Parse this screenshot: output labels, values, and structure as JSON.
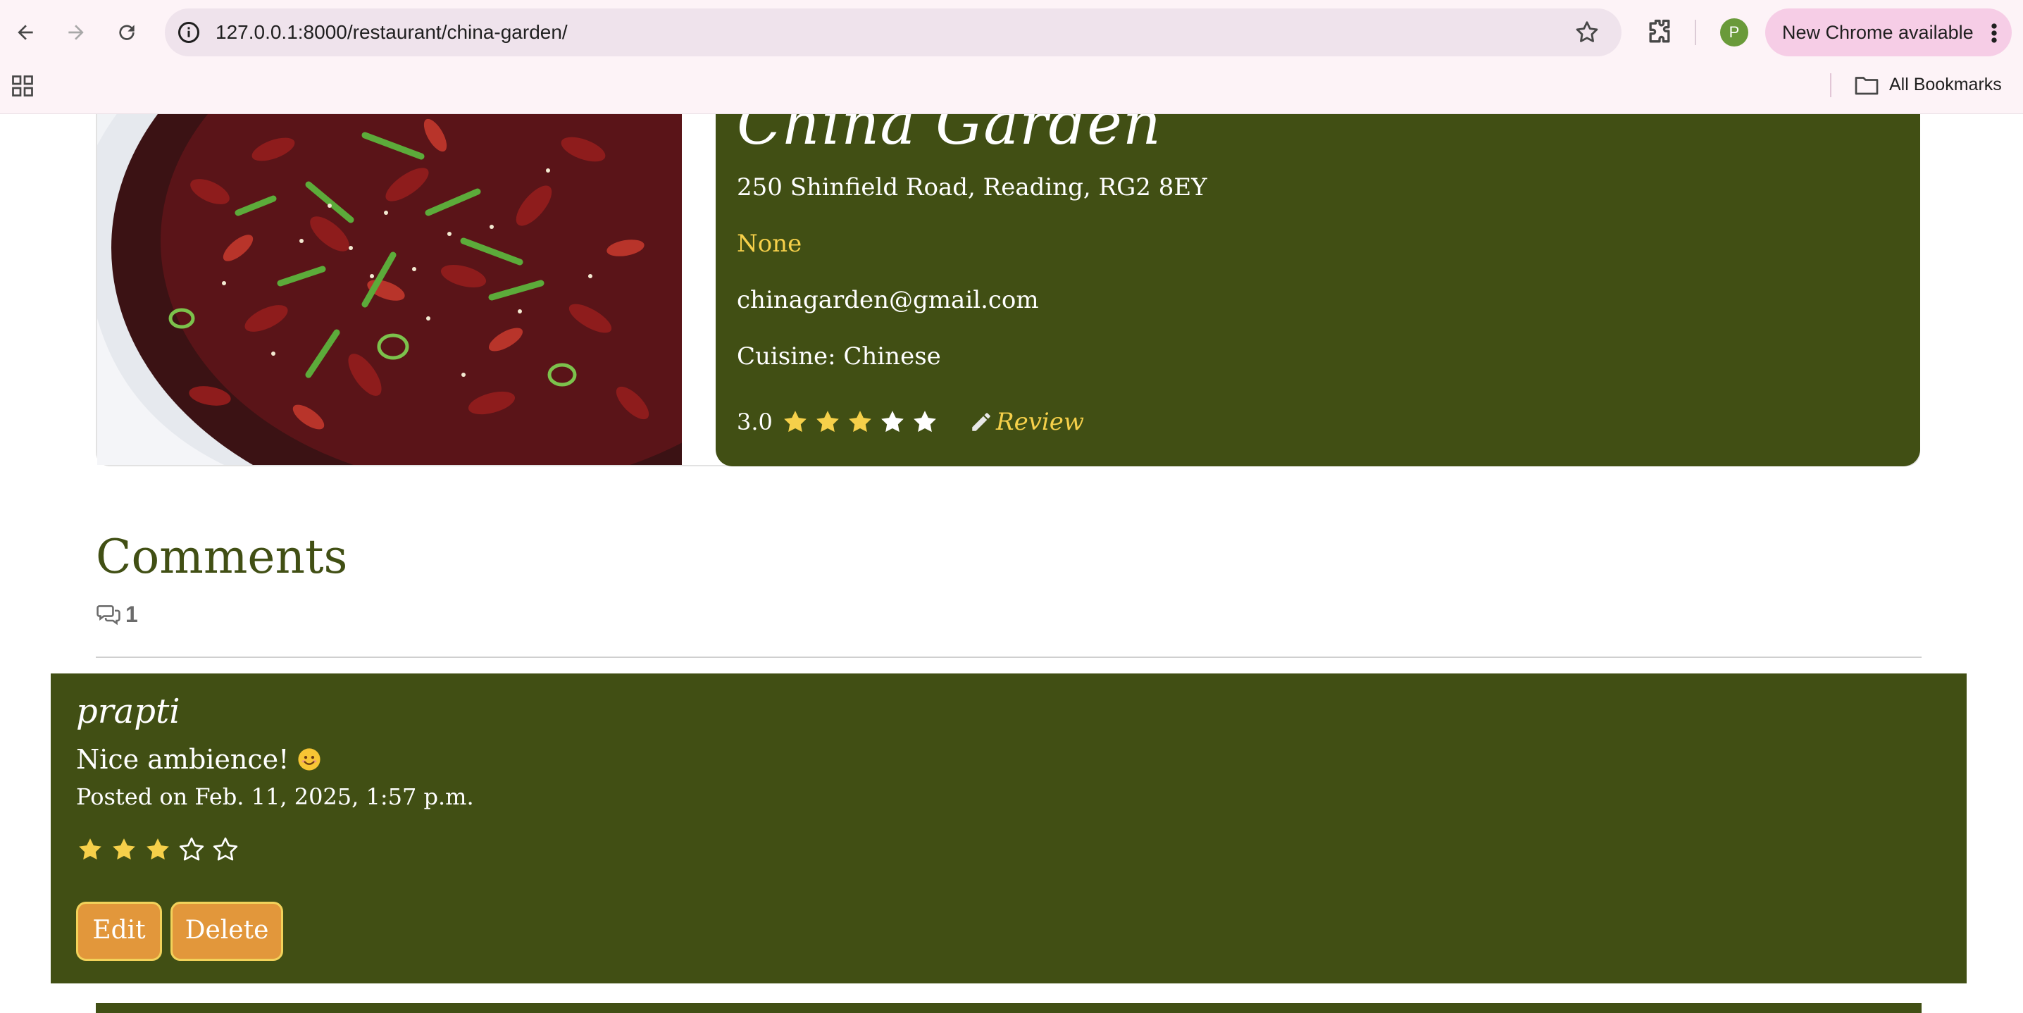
{
  "browser": {
    "url": "127.0.0.1:8000/restaurant/china-garden/",
    "profile_initial": "P",
    "update_label": "New Chrome available",
    "bookmarks_label": "All Bookmarks"
  },
  "restaurant": {
    "name": "China Garden",
    "address": "250 Shinfield Road, Reading, RG2 8EY",
    "phone": "None",
    "email": "chinagarden@gmail.com",
    "cuisine": "Cuisine: Chinese",
    "rating_text": "3.0",
    "rating_value": 3,
    "rating_max": 5,
    "review_link": "Review"
  },
  "comments": {
    "title": "Comments",
    "count": "1",
    "items": [
      {
        "author": "prapti",
        "body": "Nice ambience!",
        "posted": "Posted on Feb. 11, 2025, 1:57 p.m.",
        "rating": 3,
        "edit_label": "Edit",
        "delete_label": "Delete"
      }
    ]
  },
  "colors": {
    "panel_green": "#414f14",
    "accent_yellow": "#f6d04a",
    "button_orange": "#e2973b"
  }
}
